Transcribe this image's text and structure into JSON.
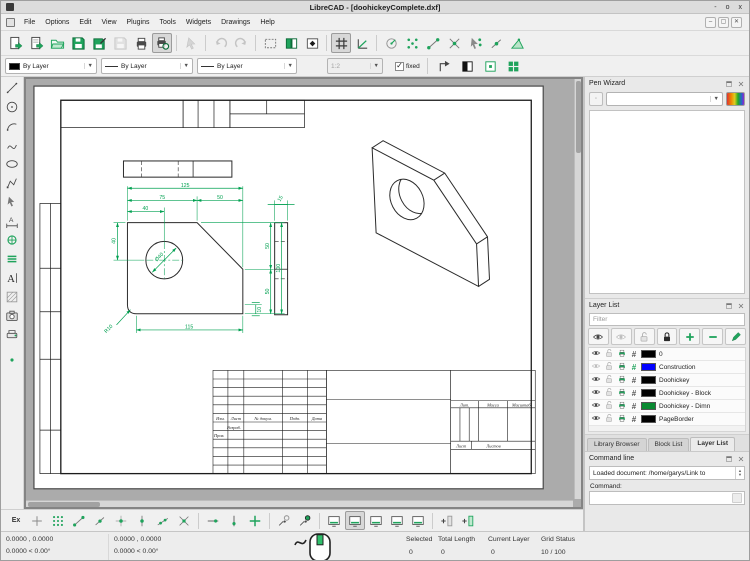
{
  "titlebar": {
    "title": "LibreCAD - [doohickeyComplete.dxf]",
    "minimize": "-",
    "maximize": "o",
    "close": "x"
  },
  "menubar": {
    "items": [
      "File",
      "Options",
      "Edit",
      "View",
      "Plugins",
      "Tools",
      "Widgets",
      "Drawings",
      "Help"
    ]
  },
  "toolbar_file": {
    "items": [
      {
        "name": "new-drawing",
        "icon": "doc-new"
      },
      {
        "name": "new-from-template",
        "icon": "doc-new-template"
      },
      {
        "name": "open-drawing",
        "icon": "folder-open"
      },
      {
        "name": "save-drawing",
        "icon": "save"
      },
      {
        "name": "save-as",
        "icon": "save-as"
      },
      {
        "name": "save-all",
        "icon": "save-all",
        "state": "disabled"
      },
      {
        "name": "print",
        "icon": "print"
      },
      {
        "name": "print-preview",
        "icon": "print-preview",
        "state": "pressed"
      },
      {
        "sep": true
      },
      {
        "name": "select-pointer",
        "icon": "cursor",
        "state": "disabled"
      },
      {
        "sep": true
      },
      {
        "name": "undo",
        "icon": "undo",
        "state": "disabled"
      },
      {
        "name": "redo",
        "icon": "redo",
        "state": "disabled"
      },
      {
        "sep": true
      },
      {
        "name": "selection-window",
        "icon": "sel-rect"
      },
      {
        "name": "previous-view",
        "icon": "panels"
      },
      {
        "name": "zoom-window",
        "icon": "panel-diamond"
      },
      {
        "sep": true
      },
      {
        "name": "grid-toggle",
        "icon": "grid-hash",
        "state": "pressed"
      },
      {
        "name": "isometric-grid",
        "icon": "ortho"
      },
      {
        "sep": true
      },
      {
        "name": "snap-free",
        "icon": "compass"
      },
      {
        "name": "snap-grid",
        "icon": "snap-grid"
      },
      {
        "name": "snap-endpoint",
        "icon": "snap-endpoint"
      },
      {
        "name": "snap-intersection",
        "icon": "snap-intersection"
      },
      {
        "name": "snap-auto",
        "icon": "snap-auto"
      },
      {
        "name": "snap-entity",
        "icon": "snap-entity"
      },
      {
        "name": "restrict-orthogonal",
        "icon": "restrict-ortho"
      }
    ]
  },
  "toolbar_pen": {
    "color_value": "By Layer",
    "linetype_value": "By Layer",
    "width_value": "By Layer",
    "scale_value": "1:2",
    "fixed_check": "✓",
    "fixed_label": "fixed",
    "buttons": [
      {
        "name": "corner-arrow",
        "icon": "corner-arrow"
      },
      {
        "name": "contrast-view",
        "icon": "half-square"
      },
      {
        "name": "entity-preview",
        "icon": "dot-square"
      },
      {
        "name": "palette-grid",
        "icon": "four-squares"
      }
    ]
  },
  "left_toolbar": {
    "items": [
      {
        "name": "draw-line",
        "icon": "line"
      },
      {
        "name": "draw-circle",
        "icon": "circle"
      },
      {
        "name": "draw-arc",
        "icon": "arc"
      },
      {
        "name": "draw-spline",
        "icon": "spline"
      },
      {
        "name": "draw-ellipse",
        "icon": "ellipse"
      },
      {
        "name": "draw-polyline",
        "icon": "polyline"
      },
      {
        "name": "select-tool",
        "icon": "select"
      },
      {
        "name": "dimension-tool",
        "icon": "dimension"
      },
      {
        "name": "modify-tool",
        "icon": "modify"
      },
      {
        "name": "order-tool",
        "icon": "order"
      },
      {
        "name": "text-tool",
        "icon": "text"
      },
      {
        "name": "hatch-tool",
        "icon": "hatch"
      },
      {
        "name": "image-tool",
        "icon": "image"
      },
      {
        "name": "block-tool",
        "icon": "block"
      },
      {
        "name": "point-tool",
        "icon": "point",
        "gap": true
      }
    ]
  },
  "snap_toolbar": {
    "items": [
      {
        "name": "exclusive-snap",
        "label": "Ex"
      },
      {
        "name": "snap-free",
        "icon": "free-plus"
      },
      {
        "name": "snap-grid",
        "icon": "grid9"
      },
      {
        "name": "snap-endpoint",
        "icon": "snap-endpoint"
      },
      {
        "name": "snap-on-entity",
        "icon": "snap-entity"
      },
      {
        "name": "snap-center",
        "icon": "snap-center"
      },
      {
        "name": "snap-middle",
        "icon": "snap-middle"
      },
      {
        "name": "snap-distance",
        "icon": "snap-distance"
      },
      {
        "name": "snap-intersection",
        "icon": "snap-intersection"
      },
      {
        "sep": true
      },
      {
        "name": "restrict-horizontal",
        "icon": "restrict-h"
      },
      {
        "name": "restrict-vertical",
        "icon": "restrict-v"
      },
      {
        "name": "restrict-nothing",
        "icon": "restrict-both"
      },
      {
        "sep": true
      },
      {
        "name": "set-relative-zero",
        "icon": "relzero-set"
      },
      {
        "name": "lock-relative-zero",
        "icon": "relzero-lock"
      },
      {
        "sep": true
      },
      {
        "name": "workspace-view-1",
        "icon": "monitor"
      },
      {
        "name": "workspace-view-2",
        "icon": "monitor",
        "state": "pressed"
      },
      {
        "name": "workspace-view-3",
        "icon": "monitor"
      },
      {
        "name": "workspace-view-4",
        "icon": "monitor"
      },
      {
        "name": "workspace-view-5",
        "icon": "monitor"
      },
      {
        "sep": true
      },
      {
        "name": "add-toolbar",
        "icon": "tb-add"
      },
      {
        "name": "add-toolbar-alt",
        "icon": "tb-add2"
      }
    ]
  },
  "pen_wizard": {
    "title": "Pen Wizard",
    "combo_value": ""
  },
  "layer_list": {
    "title": "Layer List",
    "filter_placeholder": "Filter",
    "buttons": [
      {
        "name": "show-all-layers",
        "icon": "eye"
      },
      {
        "name": "hide-all-layers",
        "icon": "eye-off"
      },
      {
        "name": "unlock-all-layers",
        "icon": "lock-open"
      },
      {
        "name": "lock-all-layers",
        "icon": "lock-dark"
      },
      {
        "name": "add-layer",
        "icon": "plus-green"
      },
      {
        "name": "remove-layer",
        "icon": "minus-green"
      },
      {
        "name": "modify-layer",
        "icon": "edit-pen"
      }
    ],
    "layers": [
      {
        "name": "0",
        "color": "#000000",
        "visible": true,
        "construction": false
      },
      {
        "name": "Construction",
        "color": "#0000ff",
        "visible": false,
        "construction": true
      },
      {
        "name": "Doohickey",
        "color": "#000000",
        "visible": true,
        "construction": false
      },
      {
        "name": "Doohickey - Block",
        "color": "#000000",
        "visible": true,
        "construction": false
      },
      {
        "name": "Doohickey - Dimn",
        "color": "#0a8a32",
        "visible": true,
        "construction": false
      },
      {
        "name": "PageBorder",
        "color": "#000000",
        "visible": true,
        "construction": false
      }
    ]
  },
  "dock_tabs": {
    "tabs": [
      "Library Browser",
      "Block List",
      "Layer List"
    ],
    "active": "Layer List"
  },
  "command_line": {
    "title": "Command line",
    "history": "Loaded document: /home/garys/Link to",
    "label": "Command:"
  },
  "statusbar": {
    "abs_coords_line1": "0.0000 , 0.0000",
    "abs_coords_line2": "0.0000 < 0.00°",
    "rel_coords_line1": "0.0000 , 0.0000",
    "rel_coords_line2": "0.0000 < 0.00°",
    "selected_label": "Selected",
    "selected_value": "0",
    "total_length_label": "Total Length",
    "total_length_value": "0",
    "current_layer_label": "Current Layer",
    "current_layer_value": "0",
    "grid_status_label": "Grid Status",
    "grid_status_value": "10 / 100"
  },
  "drawing": {
    "dims": {
      "d125": "125",
      "d75": "75",
      "d50t": "50",
      "d40t": "40",
      "d40l": "40",
      "dia40": "Ø40",
      "d50rt": "50",
      "d100": "100",
      "d50rb": "50",
      "d115": "115",
      "d10": "10",
      "r10": "R10",
      "d15": "15"
    },
    "titleblock": {
      "izm": "Изм.",
      "list": "Лист",
      "ndok": "№ докум.",
      "podp": "Подп.",
      "data_col": "Дата",
      "razrab": "Разраб.",
      "prov": "Пров.",
      "lit": "Лит.",
      "massa": "Масса",
      "masshtab": "Масштаб",
      "list2": "Лист",
      "listov": "Листов"
    }
  }
}
